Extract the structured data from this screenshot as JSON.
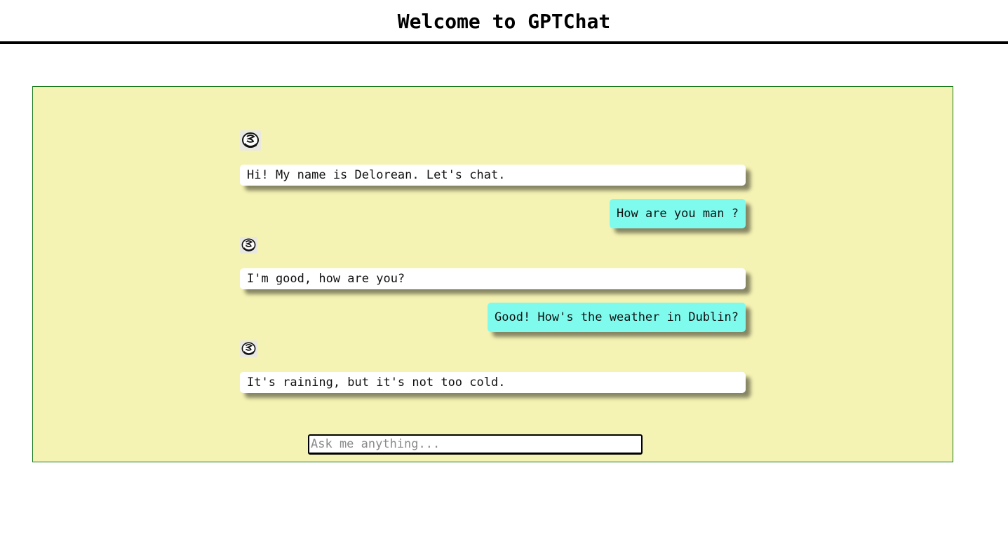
{
  "header": {
    "title": "Welcome to GPTChat"
  },
  "colors": {
    "panel_background": "#f5f3b3",
    "panel_border": "#1a7a1a",
    "bot_bubble": "#ffffff",
    "user_bubble": "#7ffbee"
  },
  "messages": [
    {
      "sender": "bot",
      "avatar_icon": "delorean-avatar-icon",
      "text": "Hi! My name is Delorean. Let's chat."
    },
    {
      "sender": "user",
      "text": "How are you man ?"
    },
    {
      "sender": "bot",
      "avatar_icon": "delorean-avatar-icon",
      "text": "I'm good, how are you?"
    },
    {
      "sender": "user",
      "text": "Good! How's the weather in Dublin?"
    },
    {
      "sender": "bot",
      "avatar_icon": "delorean-avatar-icon",
      "text": "It's raining, but it's not too cold."
    }
  ],
  "input": {
    "placeholder": "Ask me anything...",
    "value": ""
  }
}
